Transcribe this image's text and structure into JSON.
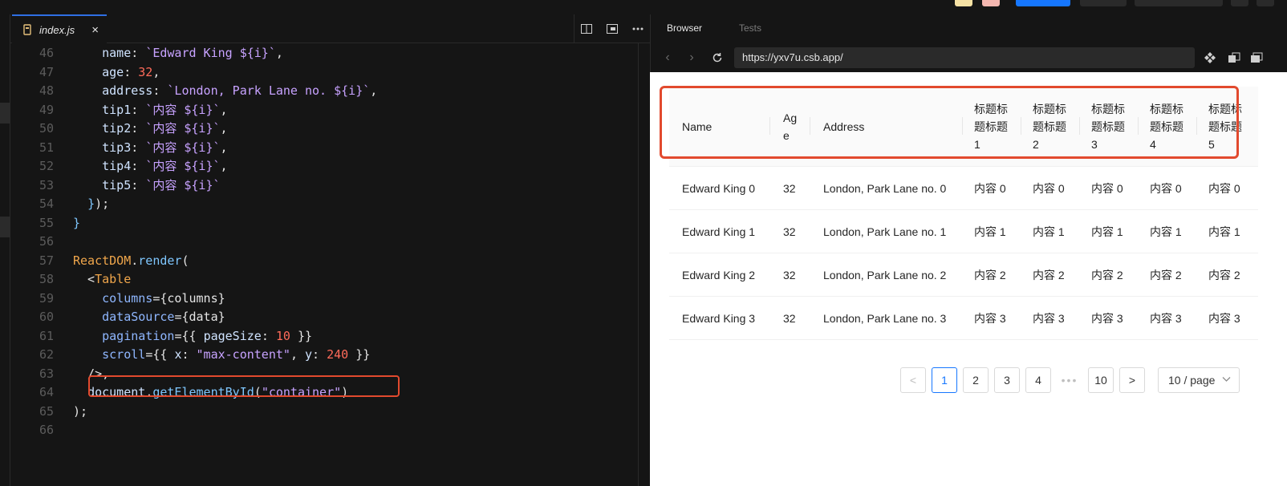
{
  "editor": {
    "tab_label": "index.js",
    "close_glyph": "×",
    "lines": [
      {
        "n": "46",
        "html": "    <span class='prop'>name</span>: <span class='str'>`Edward King ${i}`</span>,"
      },
      {
        "n": "47",
        "html": "    <span class='prop'>age</span>: <span class='num'>32</span>,"
      },
      {
        "n": "48",
        "html": "    <span class='prop'>address</span>: <span class='str'>`London, Park Lane no. ${i}`</span>,"
      },
      {
        "n": "49",
        "html": "    <span class='prop'>tip1</span>: <span class='str'>`内容 ${i}`</span>,"
      },
      {
        "n": "50",
        "html": "    <span class='prop'>tip2</span>: <span class='str'>`内容 ${i}`</span>,"
      },
      {
        "n": "51",
        "html": "    <span class='prop'>tip3</span>: <span class='str'>`内容 ${i}`</span>,"
      },
      {
        "n": "52",
        "html": "    <span class='prop'>tip4</span>: <span class='str'>`内容 ${i}`</span>,"
      },
      {
        "n": "53",
        "html": "    <span class='prop'>tip5</span>: <span class='str'>`内容 ${i}`</span>"
      },
      {
        "n": "54",
        "html": "  <span class='fn'>}</span>);"
      },
      {
        "n": "55",
        "html": "<span class='fn'>}</span>"
      },
      {
        "n": "56",
        "html": ""
      },
      {
        "n": "57",
        "html": "<span class='obj'>ReactDOM</span>.<span class='fn'>render</span>("
      },
      {
        "n": "58",
        "html": "  &lt;<span class='tag'>Table</span>"
      },
      {
        "n": "59",
        "html": "    <span class='attr'>columns</span>={columns}"
      },
      {
        "n": "60",
        "html": "    <span class='attr'>dataSource</span>={data}"
      },
      {
        "n": "61",
        "html": "    <span class='attr'>pagination</span>={{ <span class='prop'>pageSize</span>: <span class='num'>10</span> }}"
      },
      {
        "n": "62",
        "html": "    <span class='attr'>scroll</span>={{ <span class='prop'>x</span>: <span class='str'>\"max-content\"</span>, <span class='prop'>y</span>: <span class='num'>240</span> }}"
      },
      {
        "n": "63",
        "html": "  /&gt;,"
      },
      {
        "n": "64",
        "html": "  <span class='prop'>document</span>.<span class='fn'>getElementById</span>(<span class='str'>\"container\"</span>)"
      },
      {
        "n": "65",
        "html": ");"
      },
      {
        "n": "66",
        "html": ""
      }
    ]
  },
  "browser": {
    "tabs": [
      "Browser",
      "Tests"
    ],
    "url": "https://yxv7u.csb.app/"
  },
  "table": {
    "columns": [
      "Name",
      "Age",
      "Address",
      "标题标题标题1",
      "标题标题标题2",
      "标题标题标题3",
      "标题标题标题4",
      "标题标题标题5"
    ],
    "rows": [
      [
        "Edward King 0",
        "32",
        "London, Park Lane no. 0",
        "内容 0",
        "内容 0",
        "内容 0",
        "内容 0",
        "内容 0"
      ],
      [
        "Edward King 1",
        "32",
        "London, Park Lane no. 1",
        "内容 1",
        "内容 1",
        "内容 1",
        "内容 1",
        "内容 1"
      ],
      [
        "Edward King 2",
        "32",
        "London, Park Lane no. 2",
        "内容 2",
        "内容 2",
        "内容 2",
        "内容 2",
        "内容 2"
      ],
      [
        "Edward King 3",
        "32",
        "London, Park Lane no. 3",
        "内容 3",
        "内容 3",
        "内容 3",
        "内容 3",
        "内容 3"
      ]
    ]
  },
  "pagination": {
    "prev": "<",
    "next": ">",
    "pages": [
      "1",
      "2",
      "3",
      "4"
    ],
    "ellipsis": "•••",
    "last": "10",
    "active": "1",
    "page_size": "10 / page"
  },
  "colors": {
    "accent": "#1677ff",
    "highlight": "#e24a2e",
    "editor_bg": "#151515"
  }
}
